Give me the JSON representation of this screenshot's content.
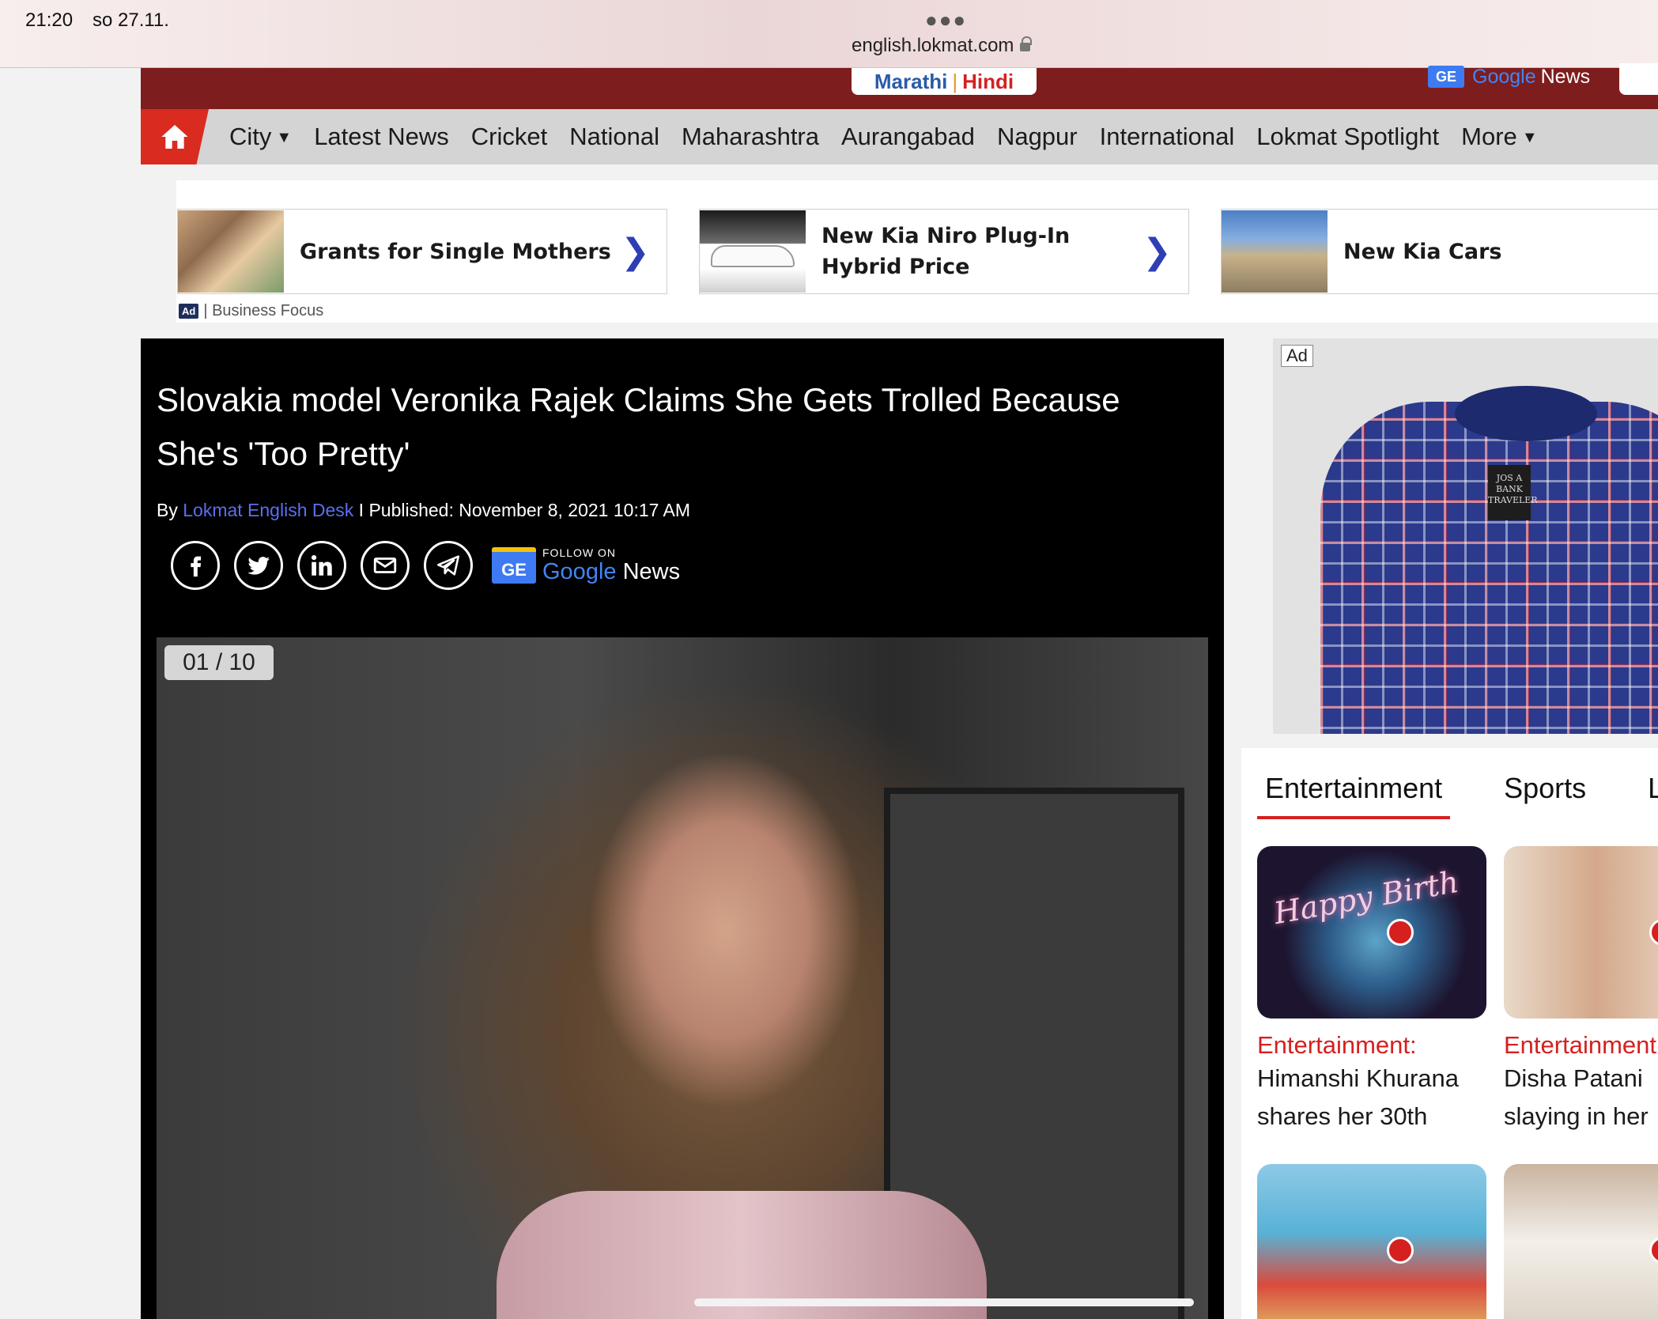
{
  "status_bar": {
    "time": "21:20",
    "date": "so 27.11.",
    "url": "english.lokmat.com"
  },
  "header": {
    "lang_marathi": "Marathi",
    "lang_sep": "|",
    "lang_hindi": "Hindi",
    "gnews_badge": "GE",
    "gnews_google": "Google",
    "gnews_news": "News"
  },
  "nav": {
    "items": [
      "City",
      "Latest News",
      "Cricket",
      "National",
      "Maharashtra",
      "Aurangabad",
      "Nagpur",
      "International",
      "Lokmat Spotlight",
      "More"
    ],
    "caret": "▼"
  },
  "sponsored": {
    "cards": [
      {
        "title": "Grants for Single Mothers",
        "chevron": "❯"
      },
      {
        "title": "New Kia Niro Plug-In Hybrid Price",
        "chevron": "❯"
      },
      {
        "title": "New Kia Cars"
      }
    ],
    "ad_badge": "Ad",
    "source": "| Business Focus"
  },
  "article": {
    "headline": "Slovakia model Veronika Rajek Claims She Gets Trolled Because She's 'Too Pretty'",
    "by_prefix": "By ",
    "author": "Lokmat English Desk",
    "published": " I Published: November 8, 2021 10:17 AM",
    "follow_small": "FOLLOW ON",
    "follow_badge": "GE",
    "follow_google": "Google",
    "follow_news": " News",
    "counter": "01 / 10"
  },
  "right_ad": {
    "tag": "Ad",
    "brand_label": "JOS A BANK TRAVELER"
  },
  "trending": {
    "tabs": [
      "Entertainment",
      "Sports",
      "Lifes"
    ],
    "cards": [
      {
        "category": "Entertainment:",
        "line1": "Himanshi Khurana",
        "line2": "shares her 30th",
        "neon": "Happy Birth"
      },
      {
        "category": "Entertainment",
        "line1": "Disha Patani",
        "line2": "slaying in her"
      },
      {
        "category": "",
        "line1": "",
        "line2": ""
      },
      {
        "category": "",
        "line1": "",
        "line2": ""
      }
    ]
  },
  "colors": {
    "brand_red": "#d62020",
    "header_maroon": "#7e1d1d",
    "nav_gray": "#d4d4d4",
    "link_blue": "#5b6ef0"
  }
}
